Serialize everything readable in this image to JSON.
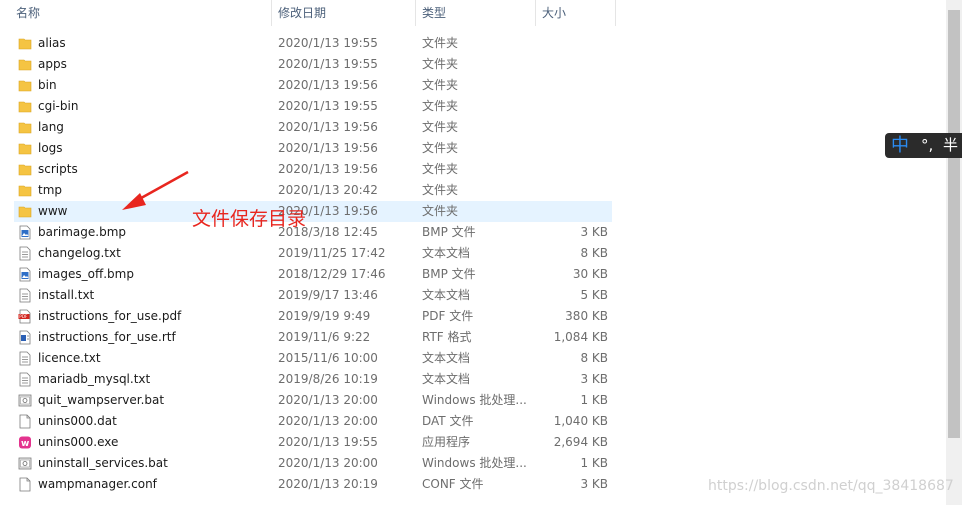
{
  "columns": {
    "name": "名称",
    "date": "修改日期",
    "type": "类型",
    "size": "大小"
  },
  "sort_indicator": "^",
  "files": [
    {
      "name": "alias",
      "date": "2020/1/13 19:55",
      "type": "文件夹",
      "size": "",
      "icon": "folder-icon"
    },
    {
      "name": "apps",
      "date": "2020/1/13 19:55",
      "type": "文件夹",
      "size": "",
      "icon": "folder-icon"
    },
    {
      "name": "bin",
      "date": "2020/1/13 19:56",
      "type": "文件夹",
      "size": "",
      "icon": "folder-icon"
    },
    {
      "name": "cgi-bin",
      "date": "2020/1/13 19:55",
      "type": "文件夹",
      "size": "",
      "icon": "folder-icon"
    },
    {
      "name": "lang",
      "date": "2020/1/13 19:56",
      "type": "文件夹",
      "size": "",
      "icon": "folder-icon"
    },
    {
      "name": "logs",
      "date": "2020/1/13 19:56",
      "type": "文件夹",
      "size": "",
      "icon": "folder-icon"
    },
    {
      "name": "scripts",
      "date": "2020/1/13 19:56",
      "type": "文件夹",
      "size": "",
      "icon": "folder-icon"
    },
    {
      "name": "tmp",
      "date": "2020/1/13 20:42",
      "type": "文件夹",
      "size": "",
      "icon": "folder-icon"
    },
    {
      "name": "www",
      "date": "2020/1/13 19:56",
      "type": "文件夹",
      "size": "",
      "icon": "folder-icon"
    },
    {
      "name": "barimage.bmp",
      "date": "2018/3/18 12:45",
      "type": "BMP 文件",
      "size": "3 KB",
      "icon": "image-file-icon"
    },
    {
      "name": "changelog.txt",
      "date": "2019/11/25 17:42",
      "type": "文本文档",
      "size": "8 KB",
      "icon": "text-file-icon"
    },
    {
      "name": "images_off.bmp",
      "date": "2018/12/29 17:46",
      "type": "BMP 文件",
      "size": "30 KB",
      "icon": "image-file-icon"
    },
    {
      "name": "install.txt",
      "date": "2019/9/17 13:46",
      "type": "文本文档",
      "size": "5 KB",
      "icon": "text-file-icon"
    },
    {
      "name": "instructions_for_use.pdf",
      "date": "2019/9/19 9:49",
      "type": "PDF 文件",
      "size": "380 KB",
      "icon": "pdf-file-icon"
    },
    {
      "name": "instructions_for_use.rtf",
      "date": "2019/11/6 9:22",
      "type": "RTF 格式",
      "size": "1,084 KB",
      "icon": "rtf-file-icon"
    },
    {
      "name": "licence.txt",
      "date": "2015/11/6 10:00",
      "type": "文本文档",
      "size": "8 KB",
      "icon": "text-file-icon"
    },
    {
      "name": "mariadb_mysql.txt",
      "date": "2019/8/26 10:19",
      "type": "文本文档",
      "size": "3 KB",
      "icon": "text-file-icon"
    },
    {
      "name": "quit_wampserver.bat",
      "date": "2020/1/13 20:00",
      "type": "Windows 批处理...",
      "size": "1 KB",
      "icon": "batch-file-icon"
    },
    {
      "name": "unins000.dat",
      "date": "2020/1/13 20:00",
      "type": "DAT 文件",
      "size": "1,040 KB",
      "icon": "blank-file-icon"
    },
    {
      "name": "unins000.exe",
      "date": "2020/1/13 19:55",
      "type": "应用程序",
      "size": "2,694 KB",
      "icon": "wamp-exe-icon"
    },
    {
      "name": "uninstall_services.bat",
      "date": "2020/1/13 20:00",
      "type": "Windows 批处理...",
      "size": "1 KB",
      "icon": "batch-file-icon"
    },
    {
      "name": "wampmanager.conf",
      "date": "2020/1/13 20:19",
      "type": "CONF 文件",
      "size": "3 KB",
      "icon": "blank-file-icon"
    }
  ],
  "annotation": "文件保存目录",
  "ime": {
    "mode": "中",
    "punct": "°,",
    "width": "半"
  },
  "watermark": "https://blog.csdn.net/qq_38418687",
  "colors": {
    "folder": "#f5c443",
    "accent_hover": "#e5f3ff",
    "annotation_red": "#e8261f"
  }
}
